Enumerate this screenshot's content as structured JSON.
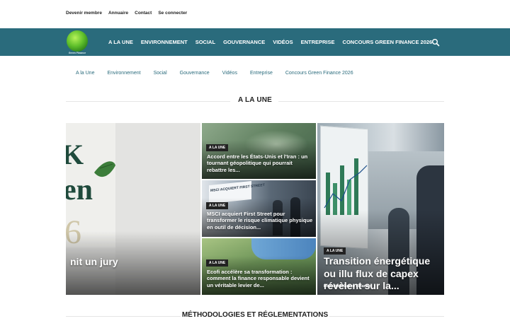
{
  "top_links": [
    "Devenir membre",
    "Annuaire",
    "Contact",
    "Se connecter"
  ],
  "logo": {
    "caption": "Green Finance"
  },
  "nav": [
    "A LA UNE",
    "ENVIRONNEMENT",
    "SOCIAL",
    "GOUVERNANCE",
    "VIDÉOS",
    "ENTREPRISE",
    "CONCOURS GREEN FINANCE 2026"
  ],
  "subnav": [
    "A la Une",
    "Environnement",
    "Social",
    "Gouvernance",
    "Vidéos",
    "Entreprise",
    "Concours Green Finance 2026"
  ],
  "section_title": "A LA UNE",
  "featured_left": {
    "title": "nit un jury"
  },
  "articles": [
    {
      "badge": "A LA UNE",
      "title": "Accord entre les États-Unis et l'Iran : un tournant géopolitique qui pourrait rebattre les..."
    },
    {
      "badge": "A LA UNE",
      "title": "MSCI acquiert First Street pour transformer le risque climatique physique en outil de décision..."
    },
    {
      "badge": "A LA UNE",
      "title": "Ecofi accélère sa transformation : comment la finance responsable devient un véritable levier de..."
    }
  ],
  "featured_right": {
    "badge": "A LA UNE",
    "title": "Transition énergétique ou illu flux de capex révèlent sur la...",
    "author": "Redaction Green Finance"
  },
  "section2_title": "MÉTHODOLOGIES ET RÉGLEMENTATIONS",
  "colors": {
    "nav_bg": "#2a6b7c",
    "accent": "#2a6b7c"
  },
  "icons": {
    "search": "search-icon"
  }
}
